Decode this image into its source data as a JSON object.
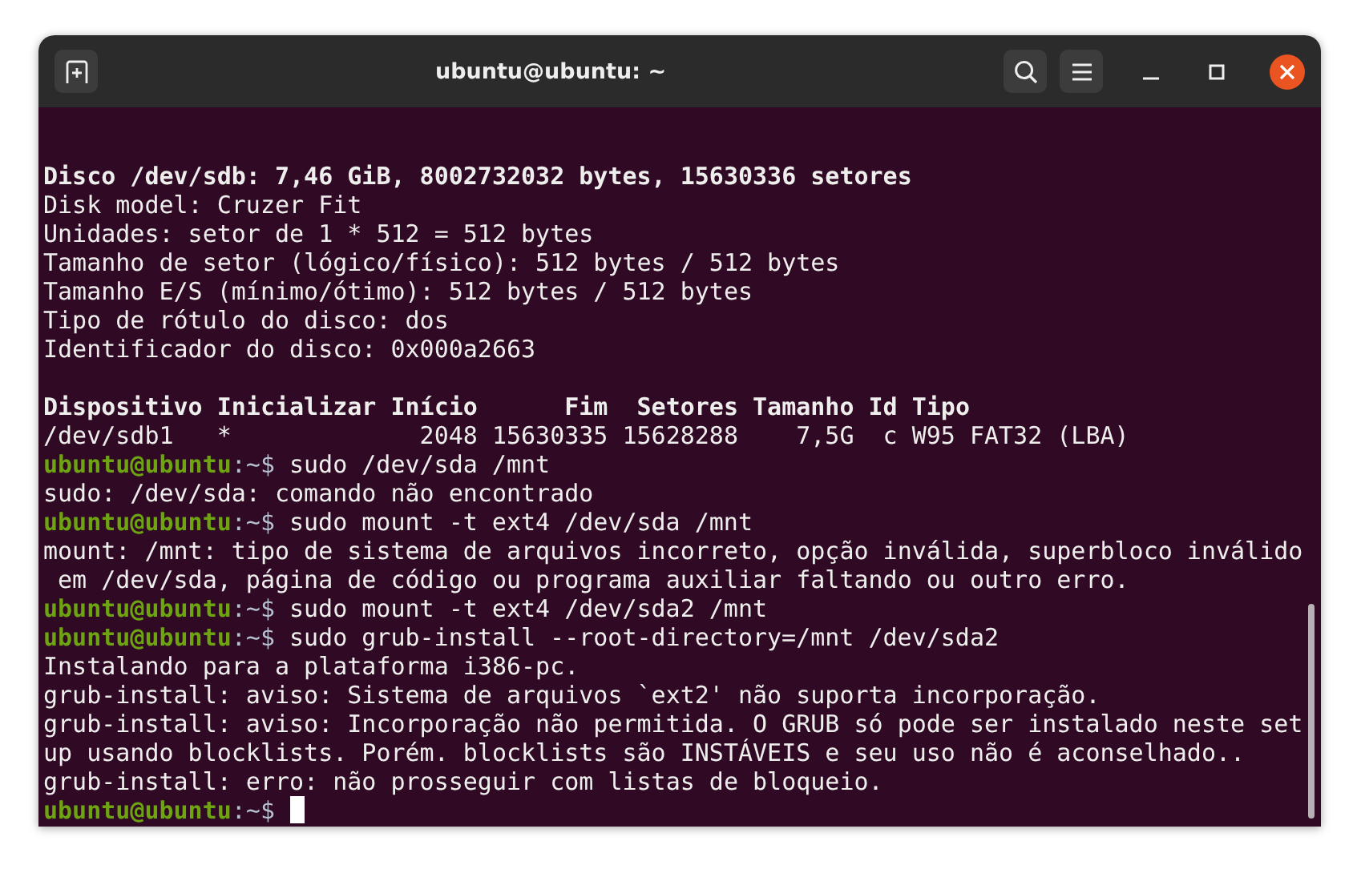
{
  "window": {
    "title": "ubuntu@ubuntu: ~"
  },
  "terminal": {
    "cursor": true,
    "lines": [
      {
        "kind": "bold",
        "text": "Disco /dev/sdb: 7,46 GiB, 8002732032 bytes, 15630336 setores"
      },
      {
        "kind": "output",
        "text": "Disk model: Cruzer Fit"
      },
      {
        "kind": "output",
        "text": "Unidades: setor de 1 * 512 = 512 bytes"
      },
      {
        "kind": "output",
        "text": "Tamanho de setor (lógico/físico): 512 bytes / 512 bytes"
      },
      {
        "kind": "output",
        "text": "Tamanho E/S (mínimo/ótimo): 512 bytes / 512 bytes"
      },
      {
        "kind": "output",
        "text": "Tipo de rótulo do disco: dos"
      },
      {
        "kind": "output",
        "text": "Identificador do disco: 0x000a2663"
      },
      {
        "kind": "blank"
      },
      {
        "kind": "bold",
        "text": "Dispositivo Inicializar Início      Fim  Setores Tamanho Id Tipo"
      },
      {
        "kind": "output",
        "text": "/dev/sdb1   *             2048 15630335 15628288    7,5G  c W95 FAT32 (LBA)"
      },
      {
        "kind": "prompt",
        "user": "ubuntu@ubuntu",
        "path": ":~$",
        "command": "sudo /dev/sda /mnt"
      },
      {
        "kind": "output",
        "text": "sudo: /dev/sda: comando não encontrado"
      },
      {
        "kind": "prompt",
        "user": "ubuntu@ubuntu",
        "path": ":~$",
        "command": "sudo mount -t ext4 /dev/sda /mnt"
      },
      {
        "kind": "output",
        "text": "mount: /mnt: tipo de sistema de arquivos incorreto, opção inválida, superbloco inválido"
      },
      {
        "kind": "output",
        "text": " em /dev/sda, página de código ou programa auxiliar faltando ou outro erro."
      },
      {
        "kind": "prompt",
        "user": "ubuntu@ubuntu",
        "path": ":~$",
        "command": "sudo mount -t ext4 /dev/sda2 /mnt"
      },
      {
        "kind": "prompt",
        "user": "ubuntu@ubuntu",
        "path": ":~$",
        "command": "sudo grub-install --root-directory=/mnt /dev/sda2"
      },
      {
        "kind": "output",
        "text": "Instalando para a plataforma i386-pc."
      },
      {
        "kind": "output",
        "text": "grub-install: aviso: Sistema de arquivos `ext2' não suporta incorporação."
      },
      {
        "kind": "output",
        "text": "grub-install: aviso: Incorporação não permitida. O GRUB só pode ser instalado neste set"
      },
      {
        "kind": "output",
        "text": "up usando blocklists. Porém. blocklists são INSTÁVEIS e seu uso não é aconselhado.."
      },
      {
        "kind": "output",
        "text": "grub-install: erro: não prosseguir com listas de bloqueio."
      },
      {
        "kind": "prompt",
        "user": "ubuntu@ubuntu",
        "path": ":~$"
      }
    ]
  }
}
